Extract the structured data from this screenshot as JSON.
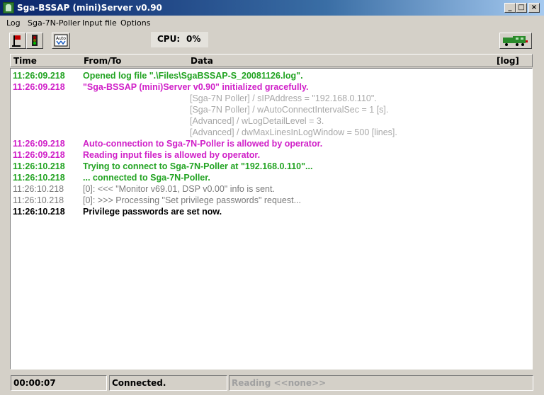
{
  "window": {
    "title": "Sga-BSSAP (mini)Server  v0.90",
    "minimize": "_",
    "maximize": "□",
    "close": "×"
  },
  "menu": [
    {
      "label": "Log"
    },
    {
      "label": "Sga-7N-Poller"
    },
    {
      "label": "Input file"
    },
    {
      "label": "Options"
    }
  ],
  "cpu": {
    "label": "CPU:",
    "value": "0%"
  },
  "toolbar": {
    "icons": [
      "flag-icon",
      "traffic-light-icon",
      "auto-button-icon",
      "train-icon"
    ],
    "auto_label": "Auto"
  },
  "columns": {
    "time": "Time",
    "from": "From/To",
    "data": "Data",
    "log": "[log]"
  },
  "colors": {
    "green": "#22a322",
    "magenta": "#d020c8",
    "gray": "#7a7a7a",
    "lightgray": "#a8a8a8",
    "black": "#000000"
  },
  "log": [
    {
      "time": "11:26:09.218",
      "msg": "Opened log file \".\\Files\\SgaBSSAP-S_20081126.log\".",
      "color": "green"
    },
    {
      "time": "11:26:09.218",
      "msg": "\"Sga-BSSAP (mini)Server  v0.90\" initialized gracefully.",
      "color": "magenta"
    },
    {
      "time": "",
      "msg": "",
      "data": "[Sga-7N Poller] / sIPAddress = \"192.168.0.110\".",
      "color": "lightgray"
    },
    {
      "time": "",
      "msg": "",
      "data": "[Sga-7N Poller] / wAutoConnectIntervalSec = 1 [s].",
      "color": "lightgray"
    },
    {
      "time": "",
      "msg": "",
      "data": "[Advanced] / wLogDetailLevel = 3.",
      "color": "lightgray"
    },
    {
      "time": "",
      "msg": "",
      "data": "[Advanced] / dwMaxLinesInLogWindow = 500 [lines].",
      "color": "lightgray"
    },
    {
      "time": "11:26:09.218",
      "msg": "Auto-connection to Sga-7N-Poller is allowed by operator.",
      "color": "magenta"
    },
    {
      "time": "11:26:09.218",
      "msg": "Reading input files is allowed by operator.",
      "color": "magenta"
    },
    {
      "time": "11:26:10.218",
      "msg": "Trying to connect to Sga-7N-Poller at \"192.168.0.110\"...",
      "color": "green"
    },
    {
      "time": "11:26:10.218",
      "msg": "... connected to Sga-7N-Poller.",
      "color": "green"
    },
    {
      "time": "11:26:10.218",
      "msg": "[0]: <<< \"Monitor v69.01, DSP v0.00\" info is sent.",
      "color": "gray"
    },
    {
      "time": "11:26:10.218",
      "msg": "[0]: >>> Processing \"Set privilege passwords\" request...",
      "color": "gray"
    },
    {
      "time": "11:26:10.218",
      "msg": "Privilege passwords are set now.",
      "color": "black"
    }
  ],
  "status": {
    "elapsed": "00:00:07",
    "connection": "Connected.",
    "reading": "Reading <<none>>"
  }
}
